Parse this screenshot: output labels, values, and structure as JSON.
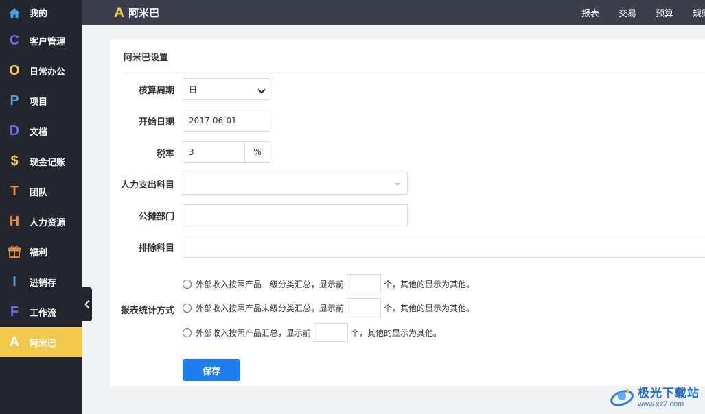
{
  "sidebar": {
    "items": [
      {
        "icon": "home-icon",
        "glyph": "",
        "label": "我的",
        "color": "#4aa3df"
      },
      {
        "icon": "letter-c-icon",
        "glyph": "C",
        "label": "客户管理",
        "color": "#6c6cf0"
      },
      {
        "icon": "letter-o-icon",
        "glyph": "O",
        "label": "日常办公",
        "color": "#f2c94c"
      },
      {
        "icon": "letter-p-icon",
        "glyph": "P",
        "label": "项目",
        "color": "#4aa3df"
      },
      {
        "icon": "letter-d-icon",
        "glyph": "D",
        "label": "文档",
        "color": "#6c6cf0"
      },
      {
        "icon": "dollar-icon",
        "glyph": "$",
        "label": "现金记账",
        "color": "#f2c94c"
      },
      {
        "icon": "letter-t-icon",
        "glyph": "T",
        "label": "团队",
        "color": "#f08c3a"
      },
      {
        "icon": "letter-h-icon",
        "glyph": "H",
        "label": "人力资源",
        "color": "#f08c3a"
      },
      {
        "icon": "gift-icon",
        "glyph": "",
        "label": "福利",
        "color": "#f08c3a"
      },
      {
        "icon": "letter-i-icon",
        "glyph": "I",
        "label": "进销存",
        "color": "#4aa3df"
      },
      {
        "icon": "letter-f-icon",
        "glyph": "F",
        "label": "工作流",
        "color": "#6c6cf0"
      },
      {
        "icon": "letter-a-icon",
        "glyph": "A",
        "label": "阿米巴",
        "color": "#ffffff"
      }
    ]
  },
  "header": {
    "brand_glyph": "A",
    "title": "阿米巴",
    "nav": [
      "报表",
      "交易",
      "预算",
      "规则"
    ]
  },
  "panel": {
    "title": "阿米巴设置",
    "period_label": "核算周期",
    "period_value": "日",
    "start_label": "开始日期",
    "start_value": "2017-06-01",
    "tax_label": "税率",
    "tax_value": "3",
    "tax_unit": "%",
    "hr_label": "人力支出科目",
    "hr_value": "",
    "dept_label": "公摊部门",
    "dept_value": "",
    "exclude_label": "排除科目",
    "exclude_value": "",
    "report_label": "报表统计方式",
    "options": [
      {
        "prefix": "外部收入按照产品一级分类汇总，显示前",
        "suffix": "个，其他的显示为其他。",
        "count": ""
      },
      {
        "prefix": "外部收入按照产品末级分类汇总，显示前",
        "suffix": "个，其他的显示为其他。",
        "count": ""
      },
      {
        "prefix": "外部收入按照产品汇总，显示前",
        "suffix": "个，其他的显示为其他。",
        "count": ""
      }
    ],
    "save_label": "保存"
  },
  "watermark": {
    "cn": "极光下载站",
    "url": "www.xz7.com"
  }
}
